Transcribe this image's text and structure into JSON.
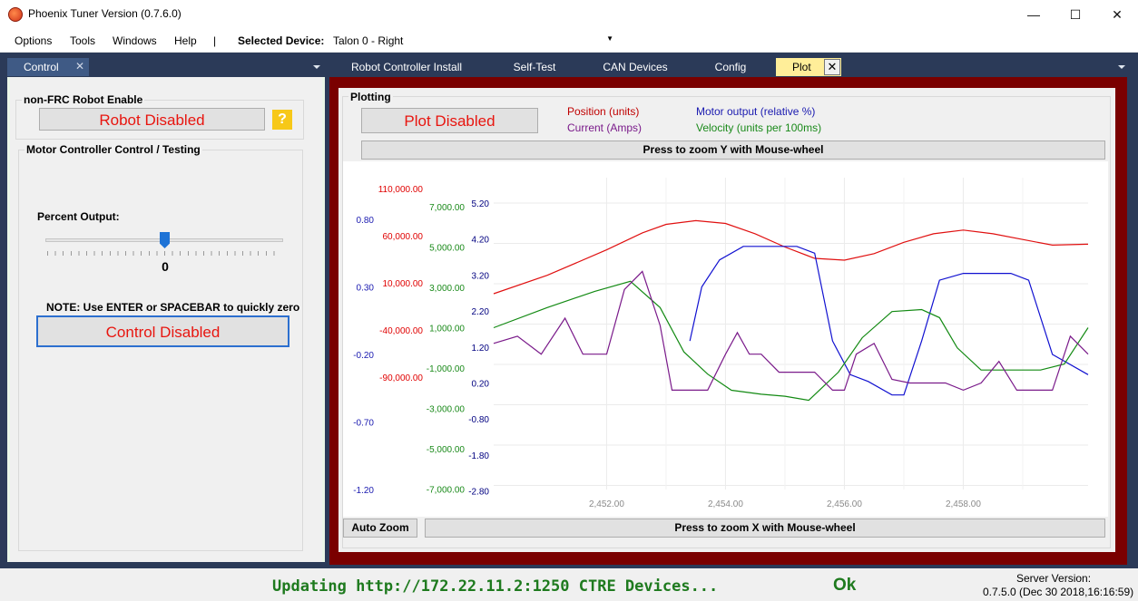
{
  "window": {
    "title": "Phoenix Tuner Version (0.7.6.0)",
    "minimize": "—",
    "maximize": "☐",
    "close": "✕"
  },
  "menu": {
    "items": [
      "Options",
      "Tools",
      "Windows",
      "Help"
    ],
    "separator": "|",
    "selected_device_label": "Selected Device:",
    "selected_device_value": "Talon 0 -  Right"
  },
  "left_tab": {
    "label": "Control",
    "close": "✕"
  },
  "tabs": [
    {
      "label": "Robot Controller Install"
    },
    {
      "label": "Self-Test"
    },
    {
      "label": "CAN Devices"
    },
    {
      "label": "Config"
    },
    {
      "label": "Plot"
    }
  ],
  "tab_close": "✕",
  "control": {
    "robot_enable_title": "non-FRC Robot Enable",
    "robot_disabled_btn": "Robot Disabled",
    "help_btn": "?",
    "motor_title": "Motor Controller Control / Testing",
    "percent_output_label": "Percent Output:",
    "percent_output_value": "0",
    "percent_output_level": 0.5,
    "note": "NOTE: Use ENTER or SPACEBAR to quickly zero",
    "control_disabled_btn": "Control Disabled"
  },
  "plot": {
    "group_title": "Plotting",
    "plot_disabled_btn": "Plot Disabled",
    "legend": [
      {
        "text": "Position (units)",
        "color": "#c00000"
      },
      {
        "text": "Current (Amps)",
        "color": "#7a1a8a"
      },
      {
        "text": "Motor output (relative %)",
        "color": "#1a1ab0"
      },
      {
        "text": "Velocity (units per 100ms)",
        "color": "#1a8a1a"
      }
    ],
    "zoom_y_btn": "Press to zoom Y with Mouse-wheel",
    "auto_zoom_btn": "Auto Zoom",
    "zoom_x_btn": "Press to zoom X with Mouse-wheel"
  },
  "chart_data": {
    "type": "line",
    "x_ticks": [
      "2,452.00",
      "2,454.00",
      "2,456.00",
      "2,458.00"
    ],
    "x_range": [
      2450.1,
      2460.1
    ],
    "axes": [
      {
        "name": "Position (units)",
        "color": "#e00000",
        "ticks": [
          "110,000.00",
          "60,000.00",
          "10,000.00",
          "-40,000.00",
          "-90,000.00"
        ]
      },
      {
        "name": "Motor output (relative %)",
        "color": "#1a1ab0",
        "ticks": [
          "0.80",
          "0.30",
          "-0.20",
          "-0.70",
          "-1.20"
        ]
      },
      {
        "name": "Velocity (units per 100ms)",
        "color": "#1a8a1a",
        "ticks": [
          "7,000.00",
          "5,000.00",
          "3,000.00",
          "1,000.00",
          "-1,000.00",
          "-3,000.00",
          "-5,000.00",
          "-7,000.00"
        ]
      },
      {
        "name": "Current (Amps)",
        "color": "#000080",
        "ticks": [
          "5.20",
          "4.20",
          "3.20",
          "2.20",
          "1.20",
          "0.20",
          "-0.80",
          "-1.80",
          "-2.80"
        ]
      }
    ],
    "series": [
      {
        "name": "Position (units)",
        "color": "#e01010",
        "x": [
          2450.1,
          2451.0,
          2452.0,
          2452.6,
          2453.0,
          2453.5,
          2454.0,
          2454.5,
          2455.0,
          2455.5,
          2456.0,
          2456.5,
          2457.0,
          2457.5,
          2458.0,
          2458.5,
          2459.0,
          2459.5,
          2460.1
        ],
        "y": [
          -1500,
          18000,
          45000,
          63000,
          72000,
          76000,
          73000,
          62000,
          48000,
          36000,
          34000,
          41000,
          53000,
          62000,
          66000,
          62000,
          56000,
          50000,
          51000
        ]
      },
      {
        "name": "Motor output (relative %)",
        "color": "#1010d0",
        "x": [
          2453.4,
          2453.6,
          2453.9,
          2454.3,
          2454.6,
          2455.2,
          2455.5,
          2455.8,
          2456.1,
          2456.4,
          2456.8,
          2457.0,
          2457.3,
          2457.6,
          2458.0,
          2458.4,
          2458.8,
          2459.1,
          2459.5,
          2460.1
        ],
        "y": [
          -0.1,
          0.3,
          0.5,
          0.6,
          0.6,
          0.6,
          0.55,
          -0.1,
          -0.35,
          -0.4,
          -0.5,
          -0.5,
          -0.1,
          0.35,
          0.4,
          0.4,
          0.4,
          0.35,
          -0.2,
          -0.35
        ]
      },
      {
        "name": "Velocity (units per 100ms)",
        "color": "#138a13",
        "x": [
          2450.1,
          2451.0,
          2451.8,
          2452.4,
          2452.9,
          2453.3,
          2453.7,
          2454.1,
          2454.6,
          2455.0,
          2455.4,
          2455.9,
          2456.3,
          2456.8,
          2457.3,
          2457.6,
          2457.9,
          2458.3,
          2458.8,
          2459.3,
          2459.7,
          2460.1
        ],
        "y": [
          1000,
          2000,
          2800,
          3300,
          2000,
          -200,
          -1300,
          -2100,
          -2300,
          -2400,
          -2600,
          -1200,
          500,
          1800,
          1900,
          1500,
          0,
          -1100,
          -1100,
          -1100,
          -800,
          1000
        ]
      },
      {
        "name": "Current (Amps)",
        "color": "#7a1a8a",
        "x": [
          2450.1,
          2450.5,
          2450.9,
          2451.3,
          2451.6,
          2452.0,
          2452.3,
          2452.6,
          2452.9,
          2453.1,
          2453.4,
          2453.7,
          2454.0,
          2454.2,
          2454.4,
          2454.6,
          2454.9,
          2455.2,
          2455.5,
          2455.8,
          2456.0,
          2456.2,
          2456.5,
          2456.8,
          2457.1,
          2457.4,
          2457.7,
          2458.0,
          2458.3,
          2458.6,
          2458.9,
          2459.2,
          2459.5,
          2459.8,
          2460.1
        ],
        "y": [
          1.3,
          1.5,
          1.0,
          2.0,
          1.0,
          1.0,
          2.8,
          3.3,
          1.8,
          0.0,
          0.0,
          0.0,
          1.0,
          1.6,
          1.0,
          1.0,
          0.5,
          0.5,
          0.5,
          0.0,
          0.0,
          1.0,
          1.3,
          0.3,
          0.2,
          0.2,
          0.2,
          0.0,
          0.2,
          0.8,
          0.0,
          0.0,
          0.0,
          1.5,
          1.0
        ]
      }
    ]
  },
  "status": {
    "message": "Updating http://172.22.11.2:1250 CTRE Devices...",
    "ok": "Ok",
    "server_label": "Server Version:",
    "server_version": "0.7.5.0 (Dec 30 2018,16:16:59)"
  }
}
